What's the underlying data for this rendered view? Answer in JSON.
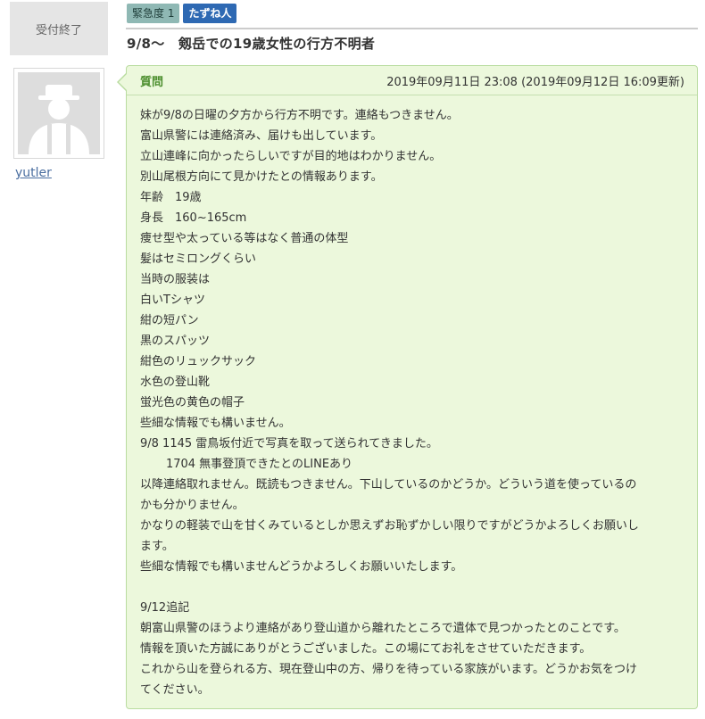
{
  "status": "受付終了",
  "badges": {
    "urgency": "緊急度 1",
    "tag": "たずね人"
  },
  "question_title": "9/8～　剱岳での19歳女性の行方不明者",
  "user": {
    "name": "yutler",
    "avatar_icon": "hat-person-icon"
  },
  "post": {
    "label": "質問",
    "date": "2019年09月11日 23:08 (2019年09月12日 16:09更新)",
    "lines": [
      "妹が9/8の日曜の夕方から行方不明です。連絡もつきません。",
      "富山県警には連絡済み、届けも出しています。",
      "立山連峰に向かったらしいですが目的地はわかりません。",
      "別山尾根方向にて見かけたとの情報あります。",
      "年齢　19歳",
      "身長　160~165cm",
      "痩せ型や太っている等はなく普通の体型",
      "髪はセミロングくらい",
      "当時の服装は",
      "白いTシャツ",
      "紺の短パン",
      "黒のスパッツ",
      "紺色のリュックサック",
      "水色の登山靴",
      "蛍光色の黄色の帽子",
      "些細な情報でも構いません。",
      "9/8 1145 雷鳥坂付近で写真を取って送られてきました。",
      "       1704 無事登頂できたとのLINEあり",
      "以降連絡取れません。既読もつきません。下山しているのかどうか。どういう道を使っているの",
      "かも分かりません。",
      "かなりの軽装で山を甘くみているとしか思えずお恥ずかしい限りですがどうかよろしくお願いし",
      "ます。",
      "些細な情報でも構いませんどうかよろしくお願いいたします。",
      "",
      "9/12追記",
      "朝富山県警のほうより連絡があり登山道から離れたところで遺体で見つかったとのことです。",
      "情報を頂いた方誠にありがとうございました。この場にてお礼をさせていただきます。",
      "これから山を登られる方、現在登山中の方、帰りを待っている家族がいます。どうかお気をつけ",
      "てください。"
    ]
  }
}
